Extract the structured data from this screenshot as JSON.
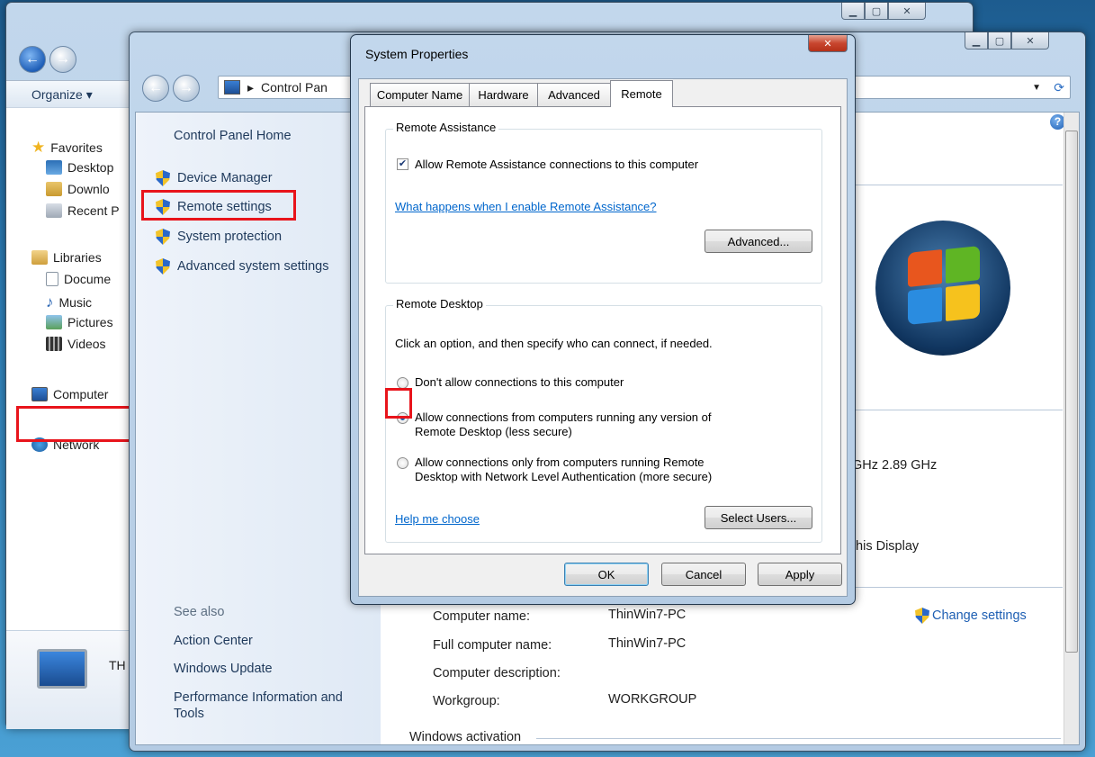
{
  "explorer": {
    "organize_label": "Organize ▾",
    "favorites_label": "Favorites",
    "desktop_label": "Desktop",
    "downloads_label": "Downlo",
    "recent_label": "Recent P",
    "libraries_label": "Libraries",
    "documents_label": "Docume",
    "music_label": "Music",
    "pictures_label": "Pictures",
    "videos_label": "Videos",
    "computer_label": "Computer",
    "network_label": "Network",
    "details_label": "TH"
  },
  "system_window": {
    "breadcrumb": "Control Pan",
    "tasks": {
      "home": "Control Panel Home",
      "device_manager": "Device Manager",
      "remote_settings": "Remote settings",
      "system_protection": "System protection",
      "advanced_settings": "Advanced system settings"
    },
    "see_also": {
      "heading": "See also",
      "action_center": "Action Center",
      "windows_update": "Windows Update",
      "performance": "Performance Information and Tools"
    },
    "cpu_speed_fragment": "GHz  2.89 GHz",
    "display_fragment": "this Display",
    "change_settings": "Change settings",
    "computer_info": {
      "name_label": "Computer name:",
      "name_value": "ThinWin7-PC",
      "full_label": "Full computer name:",
      "full_value": "ThinWin7-PC",
      "desc_label": "Computer description:",
      "workgroup_label": "Workgroup:",
      "workgroup_value": "WORKGROUP"
    },
    "activation_heading": "Windows activation"
  },
  "dialog": {
    "title": "System Properties",
    "tabs": [
      "Computer Name",
      "Hardware",
      "Advanced",
      "Remote"
    ],
    "active_tab": "Remote",
    "remote_assistance": {
      "group_title": "Remote Assistance",
      "allow_checkbox_label": "Allow Remote Assistance connections to this computer",
      "allow_checked": true,
      "help_link": "What happens when I enable Remote Assistance?",
      "advanced_button": "Advanced..."
    },
    "remote_desktop": {
      "group_title": "Remote Desktop",
      "instructions": "Click an option, and then specify who can connect, if needed.",
      "option_none": "Don't allow connections to this computer",
      "option_any_line1": "Allow connections from computers running any version of",
      "option_any_line2": "Remote Desktop (less secure)",
      "option_nla_line1": "Allow connections only from computers running Remote",
      "option_nla_line2": "Desktop with Network Level Authentication (more secure)",
      "selected_option": "option_any",
      "help_link": "Help me choose",
      "select_users_button": "Select Users..."
    },
    "buttons": {
      "ok": "OK",
      "cancel": "Cancel",
      "apply": "Apply"
    }
  },
  "colors": {
    "highlight": "#e8141b",
    "link": "#0066cc"
  }
}
